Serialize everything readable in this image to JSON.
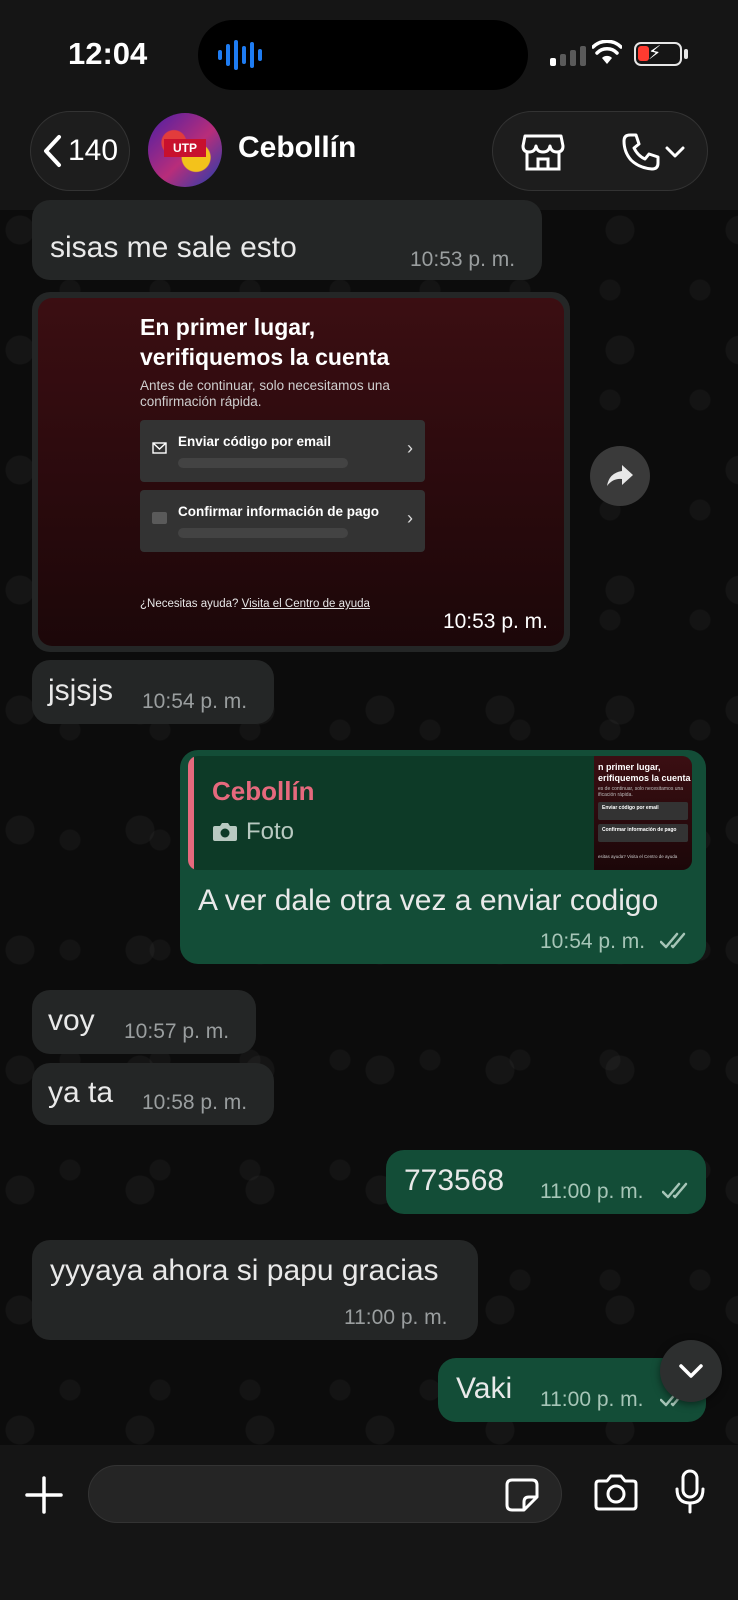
{
  "status_bar": {
    "time": "12:04",
    "colors": {
      "battery_low": "#ff3b30",
      "audio_wave": "#1e7cf2"
    }
  },
  "header": {
    "back_count": "140",
    "contact_name": "Cebollín",
    "avatar_badge": "UTP",
    "icons": [
      "chevron-left-icon",
      "store-icon",
      "phone-icon",
      "chevron-down-icon"
    ]
  },
  "colors": {
    "incoming_bubble": "#242626",
    "outgoing_bubble": "#134d37",
    "reply_accent": "#e5697d",
    "background": "#0c0c0c"
  },
  "messages": [
    {
      "id": "m1",
      "direction": "in",
      "text": "sisas me sale esto",
      "time": "10:53 p. m."
    },
    {
      "id": "m2",
      "direction": "in",
      "type": "image",
      "time": "10:53 p. m.",
      "image": {
        "title": "En primer lugar, verifiquemos la cuenta",
        "subtitle": "Antes de continuar, solo necesitamos una confirmación rápida.",
        "option1": "Enviar código por email",
        "option2": "Confirmar información de pago",
        "help_prefix": "¿Necesitas ayuda? ",
        "help_link": "Visita el Centro de ayuda"
      }
    },
    {
      "id": "m3",
      "direction": "in",
      "text": "jsjsjs",
      "time": "10:54 p. m."
    },
    {
      "id": "m4",
      "direction": "out",
      "text": "A ver dale otra vez a enviar codigo",
      "time": "10:54 p. m.",
      "reply": {
        "name": "Cebollín",
        "type": "Foto",
        "thumb_title": "n primer lugar, erifiquemos la cuenta",
        "thumb_sub": "es de continuar, solo necesitamos una ificación rápida.",
        "thumb_opt1": "Enviar código por email",
        "thumb_opt2": "Confirmar información de pago",
        "thumb_help": "esitas ayuda? Visita el Centro de ayuda"
      }
    },
    {
      "id": "m5",
      "direction": "in",
      "text": "voy",
      "time": "10:57 p. m."
    },
    {
      "id": "m6",
      "direction": "in",
      "text": "ya ta",
      "time": "10:58 p. m."
    },
    {
      "id": "m7",
      "direction": "out",
      "text": "773568",
      "time": "11:00 p. m."
    },
    {
      "id": "m8",
      "direction": "in",
      "text": "yyyaya ahora si papu gracias",
      "time": "11:00 p. m."
    },
    {
      "id": "m9",
      "direction": "out",
      "text": "Vaki",
      "time": "11:00 p. m."
    }
  ],
  "input_bar": {
    "placeholder": "",
    "icons": [
      "plus-icon",
      "sticker-icon",
      "camera-icon",
      "microphone-icon"
    ]
  }
}
